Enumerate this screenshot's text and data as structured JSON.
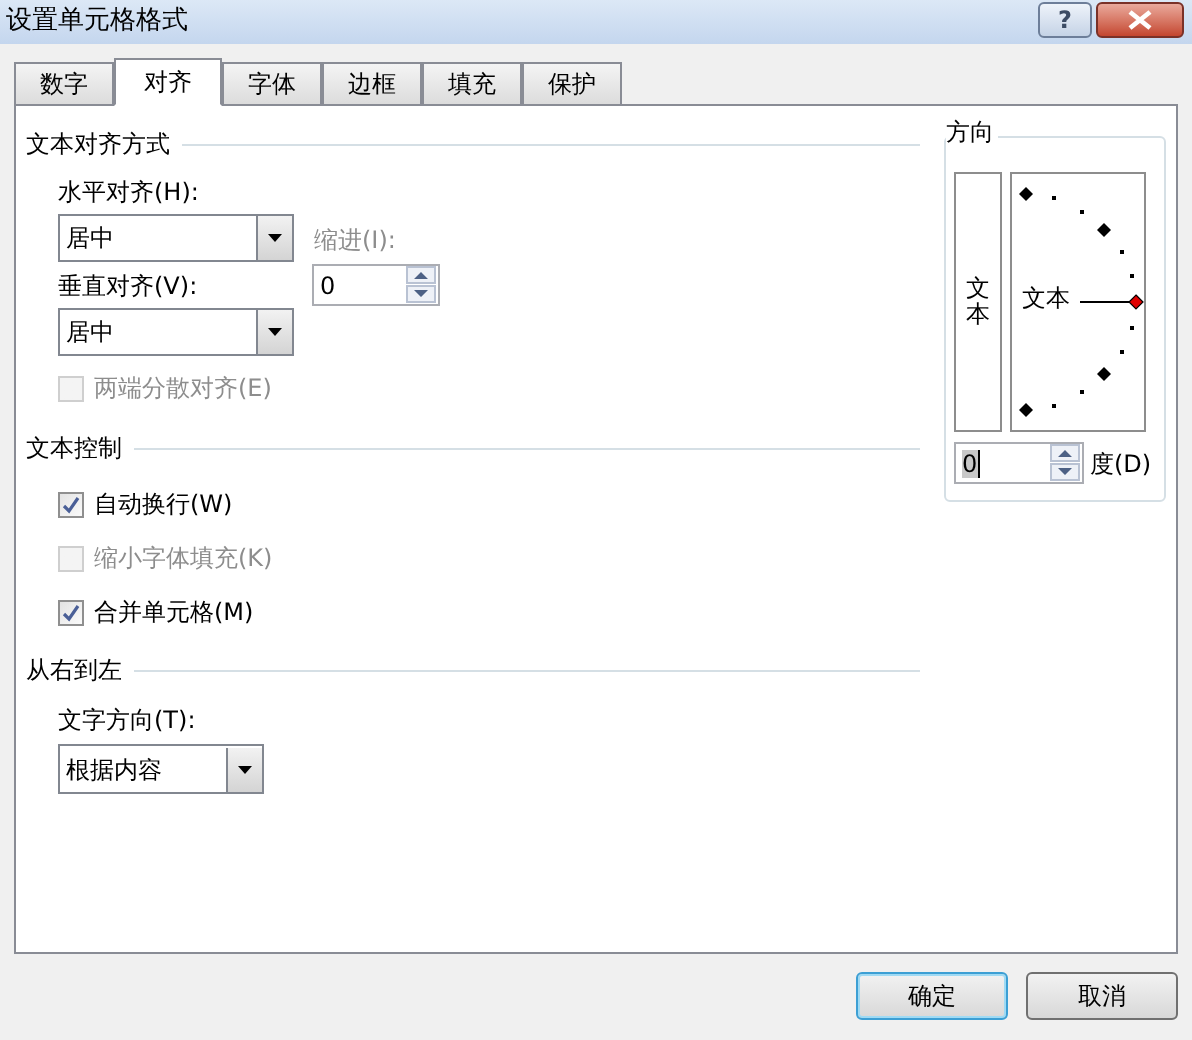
{
  "window": {
    "title": "设置单元格格式",
    "help": "?"
  },
  "tabs": [
    {
      "label": "数字",
      "selected": false
    },
    {
      "label": "对齐",
      "selected": true
    },
    {
      "label": "字体",
      "selected": false
    },
    {
      "label": "边框",
      "selected": false
    },
    {
      "label": "填充",
      "selected": false
    },
    {
      "label": "保护",
      "selected": false
    }
  ],
  "text_alignment": {
    "title": "文本对齐方式",
    "horizontal": {
      "label": "水平对齐(H):",
      "value": "居中"
    },
    "indent": {
      "label": "缩进(I):",
      "value": "0",
      "disabled": true
    },
    "vertical": {
      "label": "垂直对齐(V):",
      "value": "居中"
    },
    "distributed": {
      "label": "两端分散对齐(E)",
      "checked": false,
      "disabled": true
    }
  },
  "text_control": {
    "title": "文本控制",
    "options": [
      {
        "label": "自动换行(W)",
        "checked": true,
        "disabled": false
      },
      {
        "label": "缩小字体填充(K)",
        "checked": false,
        "disabled": true
      },
      {
        "label": "合并单元格(M)",
        "checked": true,
        "disabled": false
      }
    ]
  },
  "right_to_left": {
    "title": "从右到左",
    "direction": {
      "label": "文字方向(T):",
      "value": "根据内容"
    }
  },
  "orientation": {
    "title": "方向",
    "vertical_text": "文本",
    "dial_text": "文本",
    "degrees": {
      "value": "0",
      "unit": "度(D)"
    }
  },
  "buttons": [
    {
      "label": "确定",
      "default": true
    },
    {
      "label": "取消",
      "default": false
    }
  ]
}
